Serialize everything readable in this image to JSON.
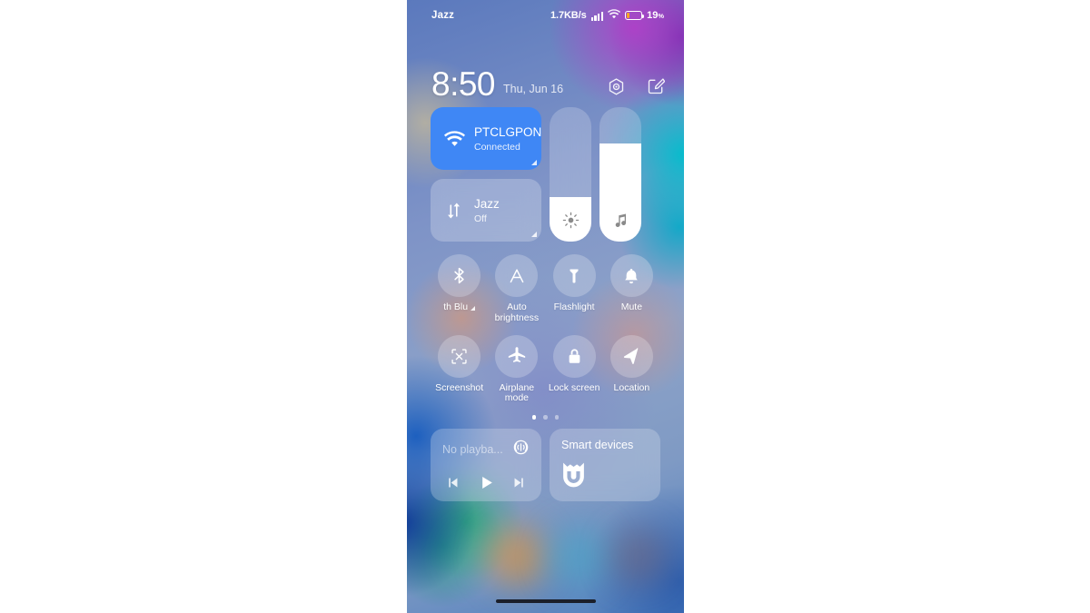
{
  "status_bar": {
    "carrier": "Jazz",
    "network_speed": "1.7KB/s",
    "signal_icon": "signal-bars-icon",
    "wifi_icon": "wifi-icon",
    "battery_icon": "battery-icon",
    "battery_percent": "19",
    "battery_percent_symbol": "%",
    "battery_level": 19,
    "battery_color": "#f5a623"
  },
  "header": {
    "time": "8:50",
    "date": "Thu, Jun 16",
    "settings_icon": "settings-gear-icon",
    "edit_icon": "edit-pencil-icon"
  },
  "connectivity": {
    "wifi_tile": {
      "name": "PTCLGPON",
      "status": "Connected",
      "icon": "wifi-icon",
      "active": true,
      "active_color": "#3f87f5",
      "expand_icon": "expand-corner-icon"
    },
    "data_tile": {
      "name": "Jazz",
      "status": "Off",
      "icon": "mobile-data-arrows-icon",
      "active": false,
      "expand_icon": "expand-corner-icon"
    }
  },
  "sliders": [
    {
      "name": "brightness",
      "icon": "brightness-sun-icon",
      "level": 33
    },
    {
      "name": "volume",
      "icon": "music-note-icon",
      "level": 73
    }
  ],
  "toggles": [
    [
      {
        "label": "th  Blu",
        "full_label": "Bluetooth",
        "icon": "bluetooth-icon",
        "marquee": true,
        "has_expand": true
      },
      {
        "label": "Auto brightness",
        "icon": "auto-brightness-a-icon",
        "marquee": false,
        "has_expand": false
      },
      {
        "label": "Flashlight",
        "icon": "flashlight-icon",
        "marquee": false,
        "has_expand": false
      },
      {
        "label": "Mute",
        "icon": "bell-mute-icon",
        "marquee": false,
        "has_expand": false
      }
    ],
    [
      {
        "label": "Screenshot",
        "icon": "screenshot-icon",
        "marquee": false,
        "has_expand": false
      },
      {
        "label": "Airplane mode",
        "icon": "airplane-icon",
        "marquee": false,
        "has_expand": false
      },
      {
        "label": "Lock screen",
        "icon": "lock-icon",
        "marquee": false,
        "has_expand": false
      },
      {
        "label": "Location",
        "icon": "location-arrow-icon",
        "marquee": false,
        "has_expand": false
      }
    ]
  ],
  "page_indicator": {
    "count": 3,
    "active_index": 0
  },
  "media_card": {
    "title": "No playba...",
    "cast_icon": "cast-sound-icon",
    "prev_icon": "skip-previous-icon",
    "play_icon": "play-icon",
    "next_icon": "skip-next-icon"
  },
  "smart_devices_card": {
    "title": "Smart devices",
    "icon": "mi-home-icon"
  },
  "home_indicator": "home-indicator-bar"
}
